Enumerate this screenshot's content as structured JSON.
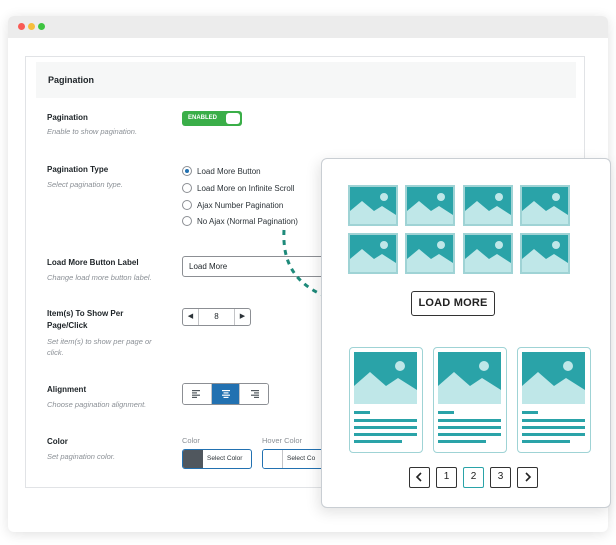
{
  "section": {
    "title": "Pagination"
  },
  "pagination": {
    "label": "Pagination",
    "desc": "Enable to show pagination.",
    "toggle": "ENABLED"
  },
  "pagination_type": {
    "label": "Pagination Type",
    "desc": "Select pagination type.",
    "options": [
      "Load More Button",
      "Load More on Infinite Scroll",
      "Ajax Number Pagination",
      "No Ajax (Normal Pagination)"
    ],
    "selected": 0
  },
  "load_more_label": {
    "label": "Load More Button Label",
    "desc": "Change load more button label.",
    "value": "Load More"
  },
  "items_per_page": {
    "label_line1": "Item(s) To Show Per",
    "label_line2": "Page/Click",
    "desc_line1": "Set item(s) to show per page or",
    "desc_line2": "click.",
    "value": "8"
  },
  "alignment": {
    "label": "Alignment",
    "desc": "Choose pagination alignment."
  },
  "color": {
    "label": "Color",
    "desc": "Set pagination color.",
    "color_label": "Color",
    "hover_label": "Hover Color",
    "select_text": "Select Color",
    "select_text_cut": "Select Co",
    "color_swatch": "#50575e"
  },
  "preview": {
    "load_more": "LOAD MORE",
    "pages": [
      "1",
      "2",
      "3"
    ],
    "active_page": "2",
    "accent": "#2aa3a8"
  }
}
